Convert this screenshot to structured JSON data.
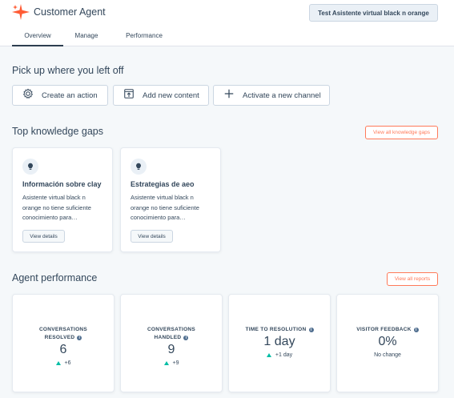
{
  "header": {
    "title": "Customer Agent",
    "test_button_label": "Test Asistente virtual black n orange",
    "tabs": [
      {
        "label": "Overview",
        "active": true
      },
      {
        "label": "Manage",
        "active": false
      },
      {
        "label": "Performance",
        "active": false
      }
    ]
  },
  "pickup": {
    "title": "Pick up where you left off",
    "actions": [
      {
        "label": "Create an action",
        "icon": "gear-icon"
      },
      {
        "label": "Add new content",
        "icon": "upload-document-icon"
      },
      {
        "label": "Activate a new channel",
        "icon": "plus-icon"
      }
    ]
  },
  "knowledge_gaps": {
    "title": "Top knowledge gaps",
    "view_all_label": "View all knowledge gaps",
    "cards": [
      {
        "title": "Información sobre clay",
        "description": "Asistente virtual black n orange no tiene suficiente conocimiento para…",
        "button_label": "View details",
        "icon": "lightbulb-icon"
      },
      {
        "title": "Estrategias de aeo",
        "description": "Asistente virtual black n orange no tiene suficiente conocimiento para…",
        "button_label": "View details",
        "icon": "lightbulb-icon"
      }
    ]
  },
  "performance": {
    "title": "Agent performance",
    "view_all_label": "View all reports",
    "metrics": [
      {
        "label_line1": "CONVERSATIONS",
        "label_line2": "RESOLVED",
        "value": "6",
        "change": "+6",
        "trend": "up"
      },
      {
        "label_line1": "CONVERSATIONS",
        "label_line2": "HANDLED",
        "value": "9",
        "change": "+9",
        "trend": "up"
      },
      {
        "label_line1": "TIME TO RESOLUTION",
        "label_line2": "",
        "value": "1 day",
        "change": "+1 day",
        "trend": "up"
      },
      {
        "label_line1": "VISITOR FEEDBACK",
        "label_line2": "",
        "value": "0%",
        "change": "No change",
        "trend": "none"
      }
    ]
  },
  "colors": {
    "accent": "#ff7a59",
    "text": "#33475b",
    "background": "#f5f8fa",
    "positive": "#00bda5"
  }
}
